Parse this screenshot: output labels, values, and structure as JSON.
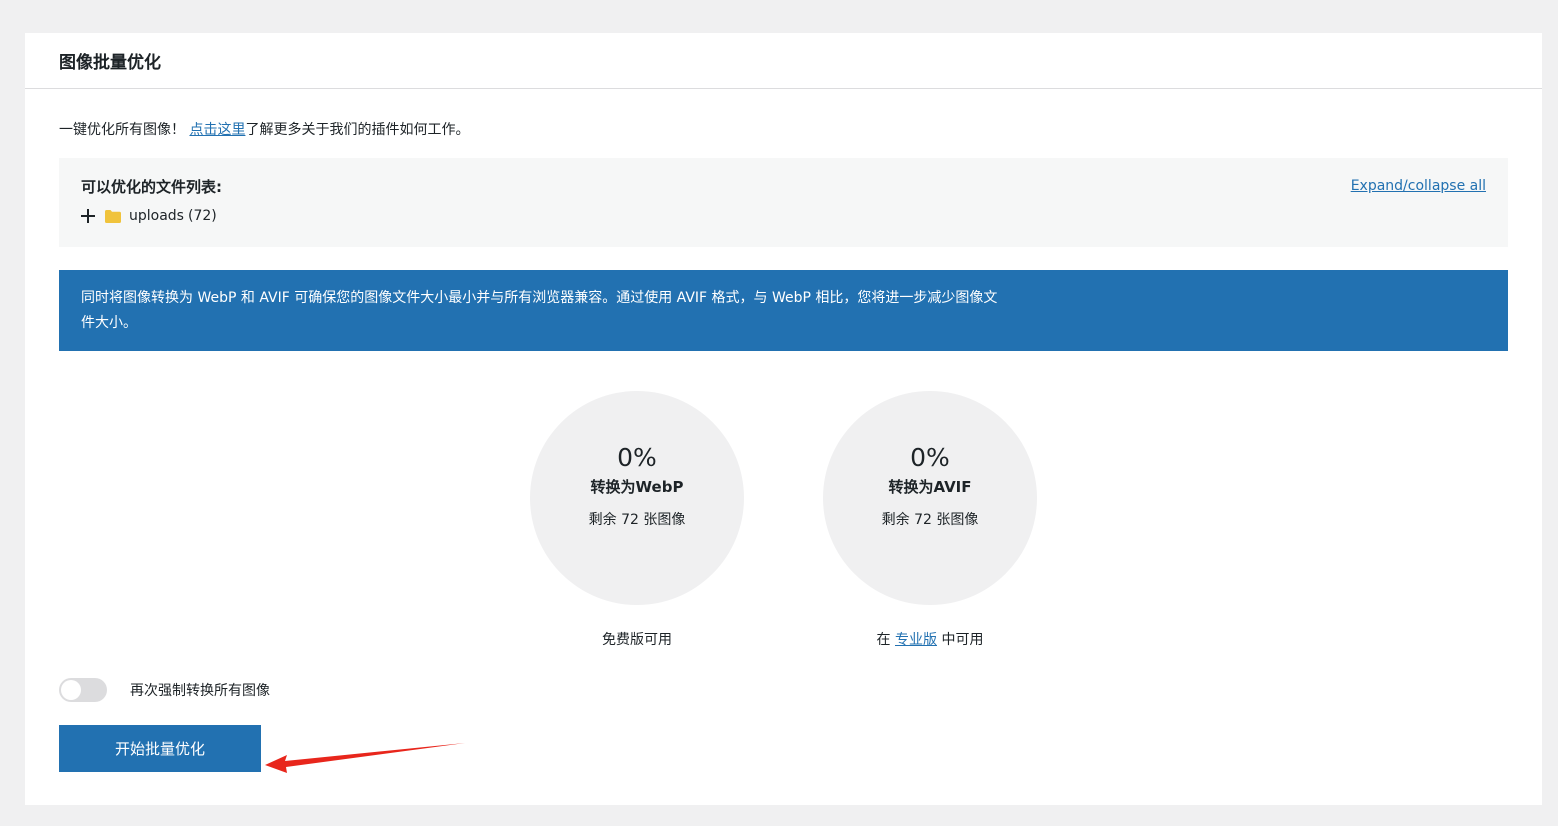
{
  "header": {
    "title": "图像批量优化"
  },
  "intro": {
    "prefix": "一键优化所有图像！",
    "link_text": "点击这里",
    "suffix": "了解更多关于我们的插件如何工作。"
  },
  "files": {
    "title": "可以优化的文件列表:",
    "expand_label": "Expand/collapse all",
    "folder_name": "uploads",
    "folder_count": "(72)"
  },
  "notice": {
    "text": "同时将图像转换为 WebP 和 AVIF 可确保您的图像文件大小最小并与所有浏览器兼容。通过使用 AVIF 格式，与 WebP 相比，您将进一步减少图像文件大小。"
  },
  "stats": {
    "webp": {
      "percent": "0%",
      "title": "转换为WebP",
      "remaining": "剩余 72 张图像",
      "note": "免费版可用"
    },
    "avif": {
      "percent": "0%",
      "title": "转换为AVIF",
      "remaining": "剩余 72 张图像",
      "note_prefix": "在",
      "note_link": "专业版",
      "note_suffix": "中可用"
    }
  },
  "force": {
    "label": "再次强制转换所有图像",
    "enabled": false
  },
  "actions": {
    "start_label": "开始批量优化"
  },
  "colors": {
    "accent": "#2271b1",
    "folder": "#f0c33c",
    "arrow": "#e8261c"
  }
}
